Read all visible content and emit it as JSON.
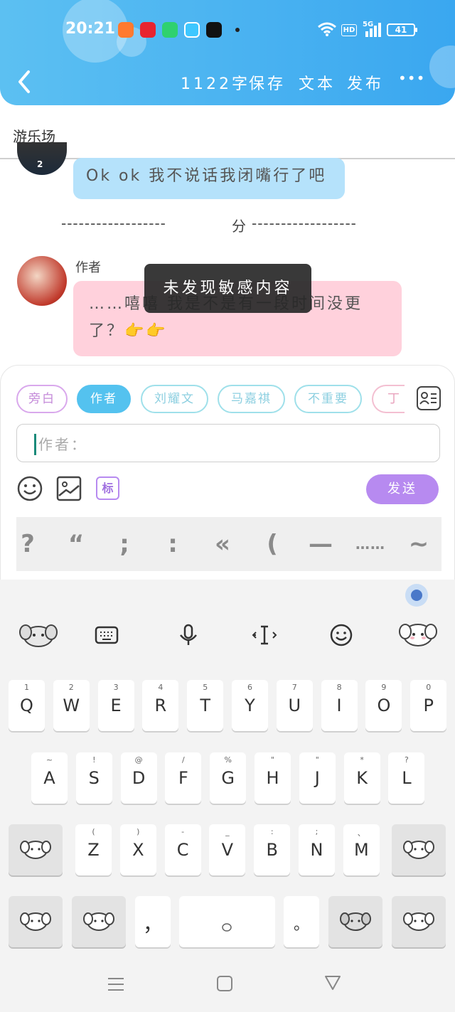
{
  "status_bar": {
    "time": "20:21",
    "hd": "HD",
    "signal": "5G",
    "battery": "41"
  },
  "header": {
    "word_count": "1122字",
    "save": "保存",
    "text": "文本",
    "publish": "发布",
    "more": "•••"
  },
  "subbar": {
    "title": "游乐场"
  },
  "chat": {
    "message_1": "Ok ok 我不说话我闭嘴行了吧",
    "divider_line_left": "------------------",
    "divider_label": "分",
    "divider_line_right": "------------------",
    "author_label": "作者",
    "message_2": "……嘻嘻 我是不是有一段时间没更了？👉👉",
    "toast": "未发现敏感内容"
  },
  "composer": {
    "roles": [
      "旁白",
      "作者",
      "刘耀文",
      "马嘉祺",
      "不重要",
      "丁程"
    ],
    "input_placeholder": "作者：",
    "tag_button": "标",
    "send_button": "发送",
    "punctuation": [
      "?",
      "“",
      ";",
      ":",
      "«",
      "(",
      "—",
      "……",
      "~"
    ]
  },
  "keyboard": {
    "row1": [
      {
        "sup": "1",
        "key": "Q"
      },
      {
        "sup": "2",
        "key": "W"
      },
      {
        "sup": "3",
        "key": "E"
      },
      {
        "sup": "4",
        "key": "R"
      },
      {
        "sup": "5",
        "key": "T"
      },
      {
        "sup": "6",
        "key": "Y"
      },
      {
        "sup": "7",
        "key": "U"
      },
      {
        "sup": "8",
        "key": "I"
      },
      {
        "sup": "9",
        "key": "O"
      },
      {
        "sup": "0",
        "key": "P"
      }
    ],
    "row2": [
      {
        "sup": "~",
        "key": "A"
      },
      {
        "sup": "!",
        "key": "S"
      },
      {
        "sup": "@",
        "key": "D"
      },
      {
        "sup": "/",
        "key": "F"
      },
      {
        "sup": "%",
        "key": "G"
      },
      {
        "sup": "\"",
        "key": "H"
      },
      {
        "sup": "\"",
        "key": "J"
      },
      {
        "sup": "*",
        "key": "K"
      },
      {
        "sup": "?",
        "key": "L"
      }
    ],
    "row3": [
      {
        "sup": "(",
        "key": "Z"
      },
      {
        "sup": ")",
        "key": "X"
      },
      {
        "sup": "-",
        "key": "C"
      },
      {
        "sup": "_",
        "key": "V"
      },
      {
        "sup": ":",
        "key": "B"
      },
      {
        "sup": ";",
        "key": "N"
      },
      {
        "sup": "、",
        "key": "M"
      }
    ],
    "comma": "，",
    "period": "。"
  },
  "colors": {
    "header_blue": "#3aa7f0",
    "bubble_blue": "#b5e2fb",
    "bubble_pink": "#ffd1dc",
    "send_purple": "#b78af0",
    "role_active": "#54c2ef"
  }
}
